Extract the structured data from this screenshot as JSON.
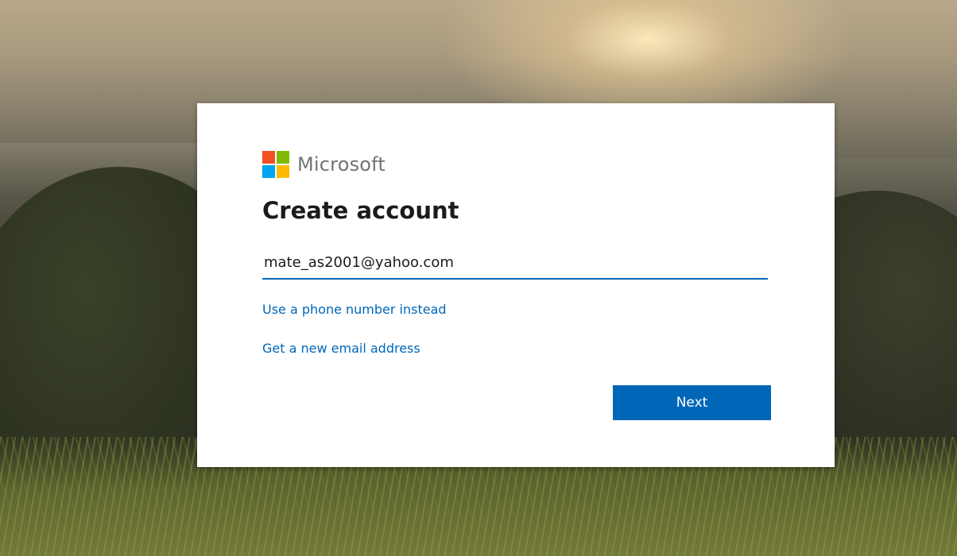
{
  "brand": {
    "name": "Microsoft",
    "logo_colors": [
      "#f25022",
      "#7fba00",
      "#00a4ef",
      "#ffb900"
    ]
  },
  "page": {
    "title": "Create account"
  },
  "email_field": {
    "value": "mate_as2001@yahoo.com"
  },
  "links": {
    "phone": "Use a phone number instead",
    "new_email": "Get a new email address"
  },
  "buttons": {
    "next": "Next"
  },
  "colors": {
    "accent": "#0067b8",
    "card_background": "#ffffff",
    "title_text": "#1b1b1b",
    "brand_text": "#737373"
  }
}
